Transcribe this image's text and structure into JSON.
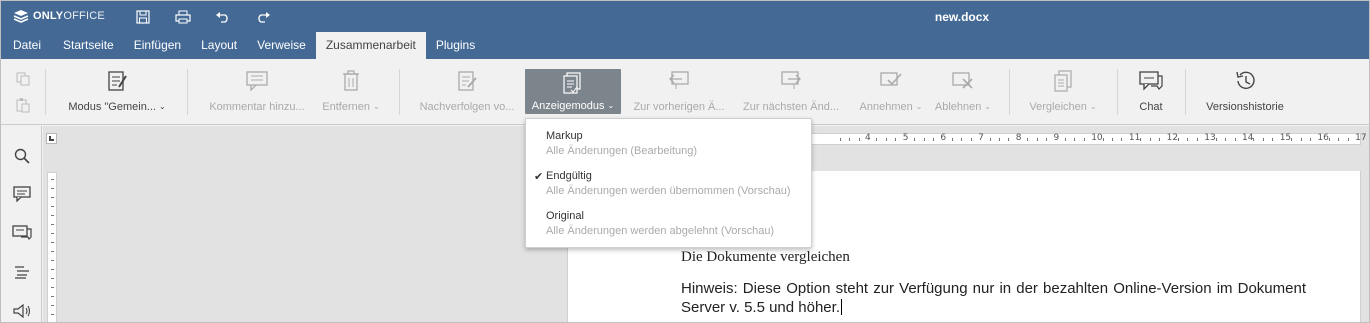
{
  "app": {
    "logo_text_1": "ONLY",
    "logo_text_2": "OFFICE",
    "doc_title": "new.docx"
  },
  "tabs": [
    "Datei",
    "Startseite",
    "Einfügen",
    "Layout",
    "Verweise",
    "Zusammenarbeit",
    "Plugins"
  ],
  "active_tab": "Zusammenarbeit",
  "toolbar": {
    "mode_label": "Modus \"Gemein...",
    "comment_label": "Kommentar hinzu...",
    "remove_label": "Entfernen",
    "track_label": "Nachverfolgen vo...",
    "display_mode_label": "Anzeigemodus",
    "prev_label": "Zur vorherigen Ä...",
    "next_label": "Zur nächsten Änd...",
    "accept_label": "Annehmen",
    "reject_label": "Ablehnen",
    "compare_label": "Vergleichen",
    "chat_label": "Chat",
    "history_label": "Versionshistorie"
  },
  "dropdown": {
    "items": [
      {
        "title": "Markup",
        "subtitle": "Alle Änderungen (Bearbeitung)",
        "checked": false
      },
      {
        "title": "Endgültig",
        "subtitle": "Alle Änderungen werden übernommen (Vorschau)",
        "checked": true
      },
      {
        "title": "Original",
        "subtitle": "Alle Änderungen werden abgelehnt (Vorschau)",
        "checked": false
      }
    ]
  },
  "document": {
    "heading": "Die Dokumente vergleichen",
    "paragraph": "Hinweis: Diese Option steht zur Verfügung nur in der bezahlten Online-Version im Dokument Server v. 5.5 und höher."
  },
  "ruler": {
    "numbers": [
      "4",
      "5",
      "6",
      "7",
      "8",
      "9",
      "10",
      "11",
      "12",
      "13",
      "14",
      "15",
      "16",
      "17"
    ]
  },
  "colors": {
    "header": "#446995",
    "toolbar_bg": "#f1f1f1",
    "pressed": "#7d858c"
  }
}
